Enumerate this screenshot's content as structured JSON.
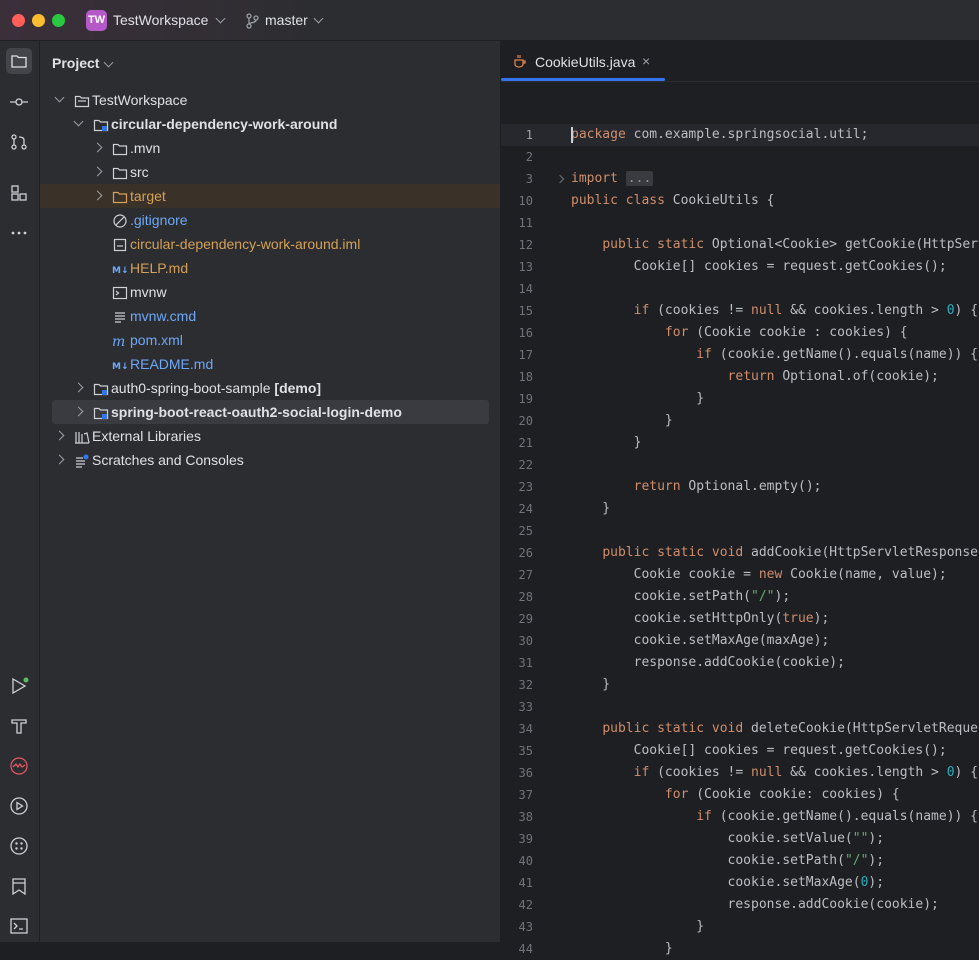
{
  "titlebar": {
    "workspace_initials": "TW",
    "workspace_name": "TestWorkspace",
    "branch": "master",
    "badge_color": "#b558c8"
  },
  "tool_strip": {
    "top": [
      "project-icon",
      "commit-icon",
      "pull-requests-icon",
      "structure-icon",
      "more-icon"
    ],
    "bottom": [
      "run-icon",
      "build-icon",
      "profiler-icon",
      "services-icon",
      "plugins-icon",
      "bookmarks-icon",
      "terminal-icon"
    ]
  },
  "project": {
    "title": "Project",
    "tree": [
      {
        "label": "TestWorkspace",
        "bold": false,
        "suffix": "",
        "indent": 0,
        "arrow": "down",
        "icon": "workspace-folder-icon",
        "color": "#dfe1e5"
      },
      {
        "label": "circular-dependency-work-around",
        "bold": true,
        "suffix": "",
        "indent": 1,
        "arrow": "down",
        "icon": "module-folder-icon",
        "color": "#dfe1e5"
      },
      {
        "label": ".mvn",
        "bold": false,
        "suffix": "",
        "indent": 2,
        "arrow": "right",
        "icon": "folder-icon",
        "color": "#dfe1e5"
      },
      {
        "label": "src",
        "bold": false,
        "suffix": "",
        "indent": 2,
        "arrow": "right",
        "icon": "folder-icon",
        "color": "#dfe1e5"
      },
      {
        "label": "target",
        "bold": false,
        "suffix": "",
        "indent": 2,
        "arrow": "right",
        "icon": "excluded-folder-icon",
        "color": "#d5a058",
        "highlight": "target"
      },
      {
        "label": ".gitignore",
        "bold": false,
        "suffix": "",
        "indent": 2,
        "arrow": "",
        "icon": "ignore-file-icon",
        "color": "#6ea8f7"
      },
      {
        "label": "circular-dependency-work-around.iml",
        "bold": false,
        "suffix": "",
        "indent": 2,
        "arrow": "",
        "icon": "iml-file-icon",
        "color": "#d5a058"
      },
      {
        "label": "HELP.md",
        "bold": false,
        "suffix": "",
        "indent": 2,
        "arrow": "",
        "icon": "markdown-icon",
        "color": "#d5a058"
      },
      {
        "label": "mvnw",
        "bold": false,
        "suffix": "",
        "indent": 2,
        "arrow": "",
        "icon": "shell-file-icon",
        "color": "#dfe1e5"
      },
      {
        "label": "mvnw.cmd",
        "bold": false,
        "suffix": "",
        "indent": 2,
        "arrow": "",
        "icon": "text-file-icon",
        "color": "#6ea8f7"
      },
      {
        "label": "pom.xml",
        "bold": false,
        "suffix": "",
        "indent": 2,
        "arrow": "",
        "icon": "maven-icon",
        "color": "#6ea8f7"
      },
      {
        "label": "README.md",
        "bold": false,
        "suffix": "",
        "indent": 2,
        "arrow": "",
        "icon": "markdown-icon",
        "color": "#6ea8f7"
      },
      {
        "label": "auth0-spring-boot-sample",
        "bold": false,
        "suffix": "[demo]",
        "indent": 1,
        "arrow": "right",
        "icon": "module-folder-icon",
        "color": "#dfe1e5"
      },
      {
        "label": "spring-boot-react-oauth2-social-login-demo",
        "bold": true,
        "suffix": "",
        "indent": 1,
        "arrow": "right",
        "icon": "module-folder-icon",
        "color": "#dfe1e5",
        "highlight": "selected"
      },
      {
        "label": "External Libraries",
        "bold": false,
        "suffix": "",
        "indent": 0,
        "arrow": "right",
        "icon": "library-icon",
        "color": "#dfe1e5"
      },
      {
        "label": "Scratches and Consoles",
        "bold": false,
        "suffix": "",
        "indent": 0,
        "arrow": "right",
        "icon": "scratches-icon",
        "color": "#dfe1e5"
      }
    ]
  },
  "editor": {
    "tab_label": "CookieUtils.java",
    "tab_close": "×",
    "lines": [
      {
        "n": "1",
        "code": "<span class=\"kw\">package</span> com.example.springsocial.util;"
      },
      {
        "n": "2",
        "code": ""
      },
      {
        "n": "3",
        "code": "<span class=\"kw\">import</span> <span class=\"fold-box\">...</span>",
        "fold": true
      },
      {
        "n": "10",
        "code": "<span class=\"kw\">public class</span> CookieUtils {"
      },
      {
        "n": "11",
        "code": ""
      },
      {
        "n": "12",
        "code": "    <span class=\"kw\">public static</span> Optional&lt;Cookie&gt; getCookie(HttpServ"
      },
      {
        "n": "13",
        "code": "        Cookie[] cookies = request.getCookies();"
      },
      {
        "n": "14",
        "code": ""
      },
      {
        "n": "15",
        "code": "        <span class=\"kw\">if</span> (cookies != <span class=\"kw\">null</span> &amp;&amp; cookies.length &gt; <span class=\"num\">0</span>) {"
      },
      {
        "n": "16",
        "code": "            <span class=\"kw\">for</span> (Cookie cookie : cookies) {"
      },
      {
        "n": "17",
        "code": "                <span class=\"kw\">if</span> (cookie.getName().equals(name)) {"
      },
      {
        "n": "18",
        "code": "                    <span class=\"kw\">return</span> Optional.of(cookie);"
      },
      {
        "n": "19",
        "code": "                }"
      },
      {
        "n": "20",
        "code": "            }"
      },
      {
        "n": "21",
        "code": "        }"
      },
      {
        "n": "22",
        "code": ""
      },
      {
        "n": "23",
        "code": "        <span class=\"kw\">return</span> Optional.empty();"
      },
      {
        "n": "24",
        "code": "    }"
      },
      {
        "n": "25",
        "code": ""
      },
      {
        "n": "26",
        "code": "    <span class=\"kw\">public static void</span> addCookie(HttpServletResponse"
      },
      {
        "n": "27",
        "code": "        Cookie cookie = <span class=\"kw\">new</span> Cookie(name, value);"
      },
      {
        "n": "28",
        "code": "        cookie.setPath(<span class=\"str\">\"/\"</span>);"
      },
      {
        "n": "29",
        "code": "        cookie.setHttpOnly(<span class=\"kw\">true</span>);"
      },
      {
        "n": "30",
        "code": "        cookie.setMaxAge(maxAge);"
      },
      {
        "n": "31",
        "code": "        response.addCookie(cookie);"
      },
      {
        "n": "32",
        "code": "    }"
      },
      {
        "n": "33",
        "code": ""
      },
      {
        "n": "34",
        "code": "    <span class=\"kw\">public static void</span> deleteCookie(HttpServletReques"
      },
      {
        "n": "35",
        "code": "        Cookie[] cookies = request.getCookies();"
      },
      {
        "n": "36",
        "code": "        <span class=\"kw\">if</span> (cookies != <span class=\"kw\">null</span> &amp;&amp; cookies.length &gt; <span class=\"num\">0</span>) {"
      },
      {
        "n": "37",
        "code": "            <span class=\"kw\">for</span> (Cookie cookie: cookies) {"
      },
      {
        "n": "38",
        "code": "                <span class=\"kw\">if</span> (cookie.getName().equals(name)) {"
      },
      {
        "n": "39",
        "code": "                    cookie.setValue(<span class=\"str\">\"\"</span>);"
      },
      {
        "n": "40",
        "code": "                    cookie.setPath(<span class=\"str\">\"/\"</span>);"
      },
      {
        "n": "41",
        "code": "                    cookie.setMaxAge(<span class=\"num\">0</span>);"
      },
      {
        "n": "42",
        "code": "                    response.addCookie(cookie);"
      },
      {
        "n": "43",
        "code": "                }"
      },
      {
        "n": "44",
        "code": "            }"
      }
    ]
  }
}
